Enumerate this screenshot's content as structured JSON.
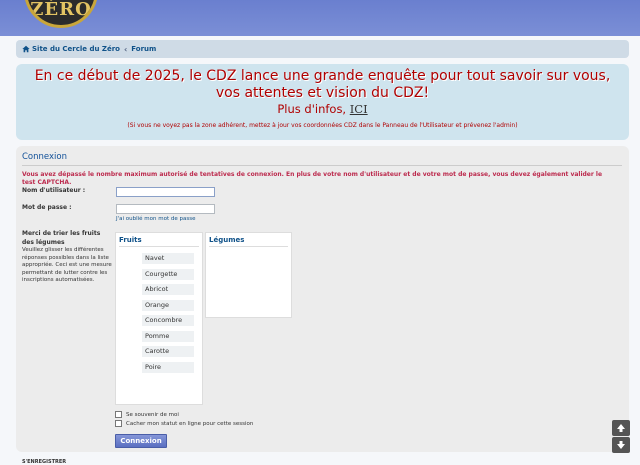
{
  "logo": {
    "text": "ZÉRO"
  },
  "breadcrumb": {
    "home": "Site du Cercle du Zéro",
    "forum": "Forum"
  },
  "announcement": {
    "headline": "En ce début de 2025, le CDZ lance une grande enquête pour tout savoir sur vous, vos attentes et vision du CDZ!",
    "info_prefix": "Plus d'infos,",
    "info_link": "ICI",
    "note": "(Si vous ne voyez pas la zone adhérent, mettez à jour vos coordonnées CDZ dans le Panneau de l'Utilisateur et prévenez l'admin)"
  },
  "login": {
    "title": "Connexion",
    "error": "Vous avez dépassé le nombre maximum autorisé de tentatives de connexion. En plus de votre nom d'utilisateur et de votre mot de passe, vous devez également valider le test CAPTCHA.",
    "username_label": "Nom d'utilisateur :",
    "username_value": "",
    "password_label": "Mot de passe :",
    "password_value": "",
    "forgot": "J'ai oublié mon mot de passe",
    "sort_title": "Merci de trier les fruits des légumes",
    "sort_help": "Veuillez glisser les différentes réponses possibles dans la liste appropriée. Ceci est une mesure permettant de lutter contre les inscriptions automatisées.",
    "fruits_title": "Fruits",
    "legumes_title": "Légumes",
    "items": [
      "Navet",
      "Courgette",
      "Abricot",
      "Orange",
      "Concombre",
      "Pomme",
      "Carotte",
      "Poire"
    ],
    "remember": "Se souvenir de moi",
    "hide_status": "Cacher mon statut en ligne pour cette session",
    "submit": "Connexion"
  },
  "footer": {
    "label": "S'ENREGISTRER"
  }
}
